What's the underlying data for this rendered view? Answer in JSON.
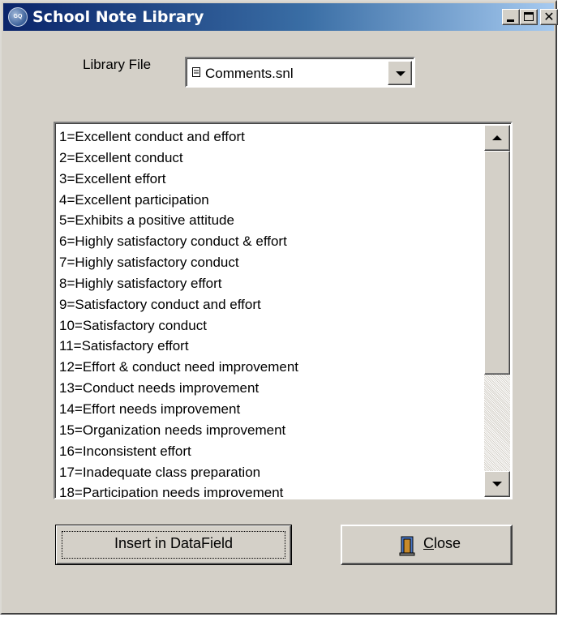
{
  "window": {
    "title": "School Note Library",
    "app_icon_text": "Grade Quick"
  },
  "library": {
    "label": "Library File",
    "selected_file": "Comments.snl"
  },
  "comments": [
    "1=Excellent conduct and effort",
    "2=Excellent conduct",
    "3=Excellent effort",
    "4=Excellent participation",
    "5=Exhibits a positive attitude",
    "6=Highly satisfactory conduct & effort",
    "7=Highly satisfactory conduct",
    "8=Highly satisfactory effort",
    "9=Satisfactory conduct and effort",
    "10=Satisfactory conduct",
    "11=Satisfactory effort",
    "12=Effort & conduct need improvement",
    "13=Conduct needs improvement",
    "14=Effort needs improvement",
    "15=Organization needs improvement",
    "16=Inconsistent effort",
    "17=Inadequate class preparation",
    "18=Participation needs improvement"
  ],
  "scrollbar": {
    "position_fraction": 0.0
  },
  "buttons": {
    "insert_label": "Insert in DataField",
    "close_mnemonic": "C",
    "close_rest": "lose"
  },
  "colors": {
    "titlebar_start": "#0a246a",
    "titlebar_end": "#a6caf0",
    "face": "#d4d0c8"
  }
}
